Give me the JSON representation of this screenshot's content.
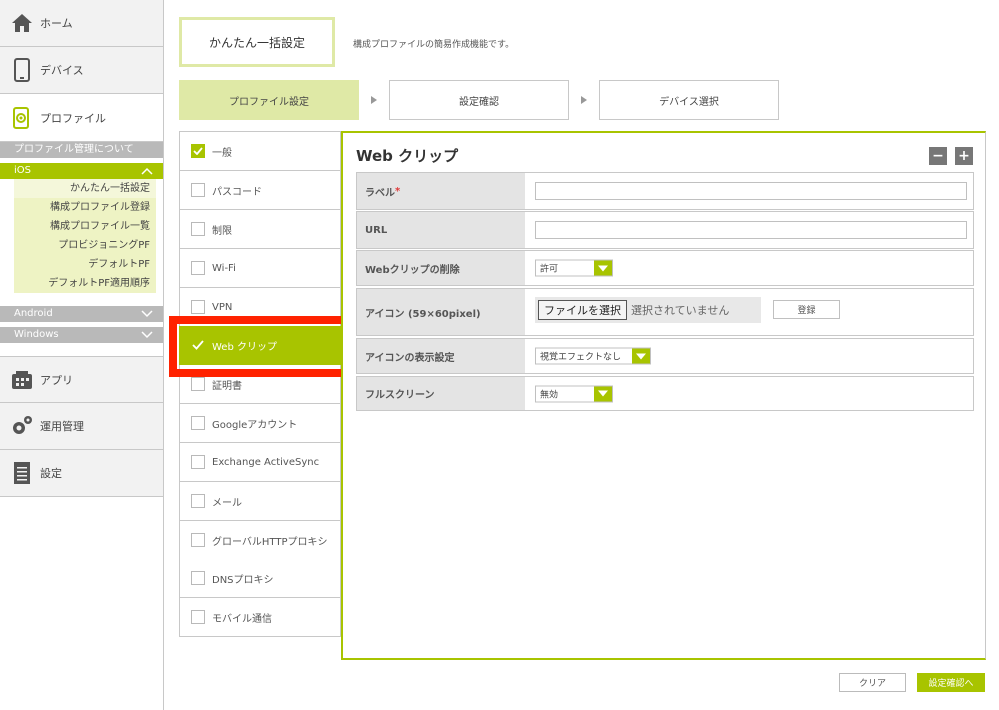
{
  "sidebar": {
    "nav": [
      {
        "label": "ホーム",
        "icon": "home-icon"
      },
      {
        "label": "デバイス",
        "icon": "device-icon"
      },
      {
        "label": "プロファイル",
        "icon": "profile-icon"
      }
    ],
    "profile_about": "プロファイル管理について",
    "ios": {
      "label": "iOS",
      "items": [
        "かんたん一括設定",
        "構成プロファイル登録",
        "構成プロファイル一覧",
        "プロビジョニングPF",
        "デフォルトPF",
        "デフォルトPF適用順序"
      ]
    },
    "android": "Android",
    "windows": "Windows",
    "bottom_nav": [
      {
        "label": "アプリ",
        "icon": "app-icon"
      },
      {
        "label": "運用管理",
        "icon": "gear-icon"
      },
      {
        "label": "設定",
        "icon": "settings-icon"
      }
    ]
  },
  "header": {
    "title": "かんたん一括設定",
    "description": "構成プロファイルの簡易作成機能です。"
  },
  "steps": [
    "プロファイル設定",
    "設定確認",
    "デバイス選択"
  ],
  "categories": [
    {
      "label": "一般",
      "checked": true
    },
    {
      "label": "パスコード",
      "checked": false
    },
    {
      "label": "制限",
      "checked": false
    },
    {
      "label": "Wi-Fi",
      "checked": false
    },
    {
      "label": "VPN",
      "checked": false
    },
    {
      "label": "Web クリップ",
      "checked": true
    },
    {
      "label": "証明書",
      "checked": false
    },
    {
      "label": "Googleアカウント",
      "checked": false
    },
    {
      "label": "Exchange ActiveSync",
      "checked": false
    },
    {
      "label": "メール",
      "checked": false
    },
    {
      "label": "グローバルHTTPプロキシ",
      "checked": false
    },
    {
      "label": "DNSプロキシ",
      "checked": false
    },
    {
      "label": "モバイル通信",
      "checked": false
    }
  ],
  "panel": {
    "title": "Web クリップ",
    "minus": "−",
    "plus": "+",
    "fields": {
      "label": {
        "label": "ラベル",
        "required_mark": "*",
        "value": ""
      },
      "url": {
        "label": "URL",
        "value": ""
      },
      "remove": {
        "label": "Webクリップの削除",
        "value": "許可"
      },
      "icon": {
        "label": "アイコン (59×60pixel)",
        "file_button": "ファイルを選択",
        "file_status": "選択されていません",
        "register": "登録"
      },
      "icon_display": {
        "label": "アイコンの表示設定",
        "value": "視覚エフェクトなし"
      },
      "fullscreen": {
        "label": "フルスクリーン",
        "value": "無効"
      }
    }
  },
  "footer": {
    "clear": "クリア",
    "confirm": "設定確認へ"
  },
  "colors": {
    "accent": "#a8c400",
    "highlight": "#ff2200",
    "sub_bg": "#b9b9b9"
  }
}
